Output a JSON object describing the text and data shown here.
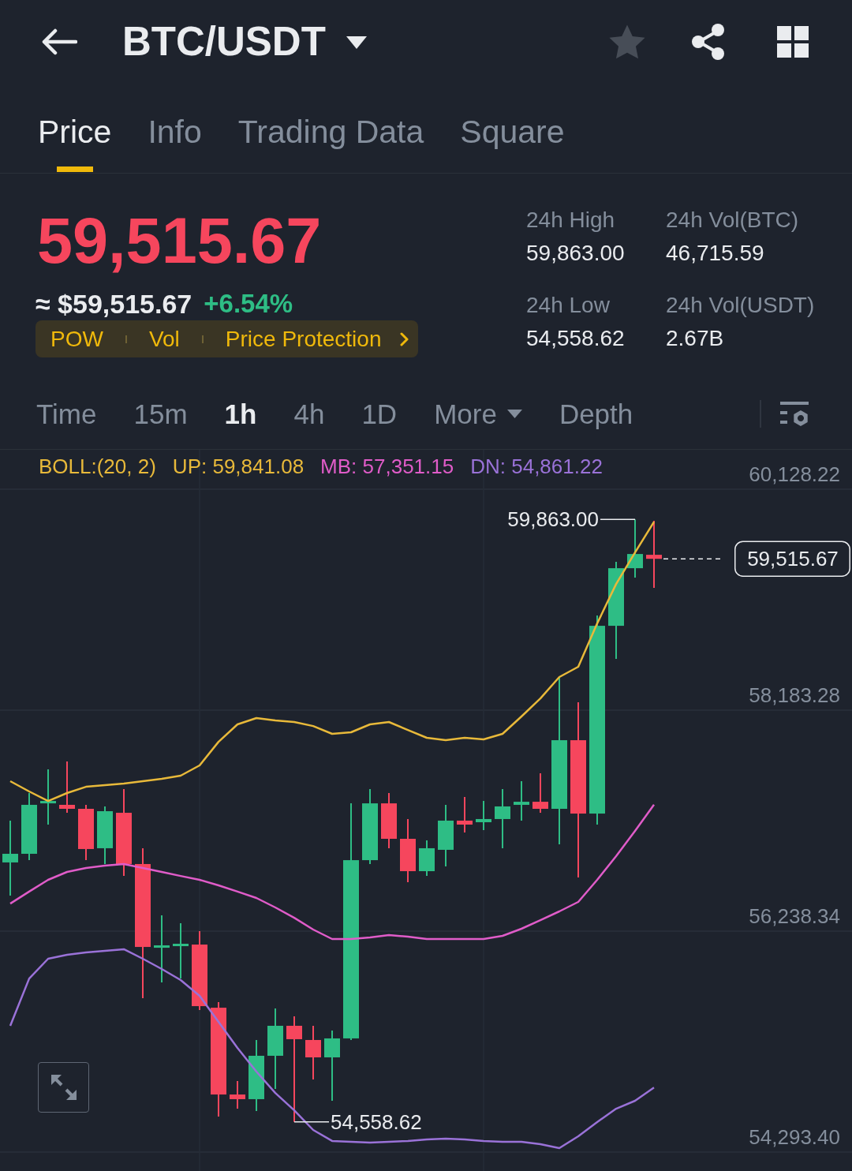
{
  "header": {
    "title": "BTC/USDT",
    "favorite": false
  },
  "tabs": [
    {
      "label": "Price",
      "selected": true
    },
    {
      "label": "Info",
      "selected": false
    },
    {
      "label": "Trading Data",
      "selected": false
    },
    {
      "label": "Square",
      "selected": false
    }
  ],
  "ticker": {
    "price": "59,515.67",
    "fiat_price": "≈ $59,515.67",
    "change": "+6.54%",
    "tags": [
      "POW",
      "Vol",
      "Price Protection"
    ],
    "stats": [
      {
        "label": "24h High",
        "value": "59,863.00"
      },
      {
        "label": "24h Vol(BTC)",
        "value": "46,715.59"
      },
      {
        "label": "24h Low",
        "value": "54,558.62"
      },
      {
        "label": "24h Vol(USDT)",
        "value": "2.67B"
      }
    ]
  },
  "intervals": [
    {
      "label": "Time",
      "selected": false,
      "dropdown": false
    },
    {
      "label": "15m",
      "selected": false,
      "dropdown": false
    },
    {
      "label": "1h",
      "selected": true,
      "dropdown": false
    },
    {
      "label": "4h",
      "selected": false,
      "dropdown": false
    },
    {
      "label": "1D",
      "selected": false,
      "dropdown": false
    },
    {
      "label": "More",
      "selected": false,
      "dropdown": true
    },
    {
      "label": "Depth",
      "selected": false,
      "dropdown": false
    }
  ],
  "chart": {
    "legend": [
      {
        "text": "BOLL:(20, 2)",
        "color": "#e8b93a"
      },
      {
        "text": "UP: 59,841.08",
        "color": "#e8b93a"
      },
      {
        "text": "MB: 57,351.15",
        "color": "#e05cc9"
      },
      {
        "text": "DN: 54,861.22",
        "color": "#9a72d8"
      }
    ],
    "high_marker": "59,863.00",
    "low_marker": "54,558.62",
    "last_price_tag": "59,515.67",
    "chart_data": {
      "type": "line",
      "grid": true,
      "ylim": [
        54126.68,
        60475.53
      ],
      "yticks": [
        {
          "value": 60128.22,
          "label": "60,128.22"
        },
        {
          "value": 58183.28,
          "label": "58,183.28"
        },
        {
          "value": 56238.34,
          "label": "56,238.34"
        },
        {
          "value": 54293.4,
          "label": "54,293.40"
        }
      ],
      "series": [
        {
          "color": "#e8b93a",
          "values": [
            57558,
            57468,
            57384,
            57454,
            57509,
            57523,
            57537,
            57558,
            57579,
            57607,
            57697,
            57905,
            58058,
            58114,
            58093,
            58079,
            58044,
            57975,
            57989,
            58058,
            58079,
            58009,
            57940,
            57919,
            57940,
            57926,
            57975,
            58128,
            58287,
            58475,
            58565,
            58947,
            59294,
            59572,
            59841
          ]
        },
        {
          "color": "#e05cc9",
          "values": [
            56481,
            56586,
            56690,
            56759,
            56794,
            56815,
            56829,
            56794,
            56759,
            56724,
            56690,
            56641,
            56586,
            56530,
            56447,
            56356,
            56252,
            56169,
            56169,
            56183,
            56204,
            56190,
            56169,
            56169,
            56169,
            56169,
            56197,
            56259,
            56335,
            56412,
            56495,
            56690,
            56898,
            57120,
            57351
          ]
        },
        {
          "color": "#9a72d8",
          "values": [
            55405,
            55821,
            55995,
            56030,
            56051,
            56065,
            56079,
            55995,
            55905,
            55808,
            55669,
            55439,
            55210,
            55002,
            54814,
            54661,
            54488,
            54391,
            54384,
            54377,
            54384,
            54391,
            54404,
            54411,
            54404,
            54391,
            54384,
            54384,
            54363,
            54328,
            54432,
            54557,
            54675,
            54745,
            54861
          ]
        }
      ]
    }
  }
}
